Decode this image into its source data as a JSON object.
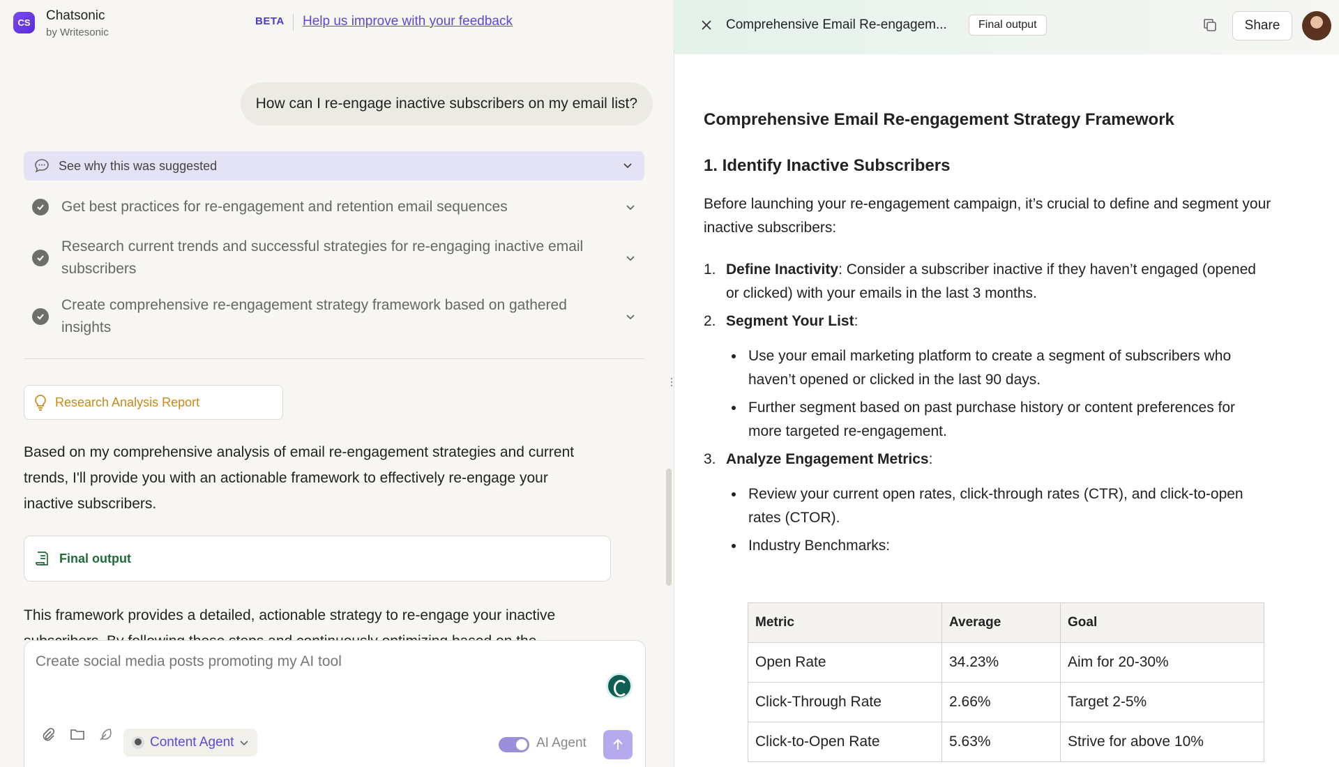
{
  "header": {
    "logo_text": "CS",
    "app_name": "Chatsonic",
    "app_sub": "by Writesonic",
    "beta": "BETA",
    "feedback_link": "Help us improve with your feedback"
  },
  "chat": {
    "user_message": "How can I re-engage inactive subscribers on my email list?",
    "why_suggested": "See why this was suggested",
    "steps": [
      "Get best practices for re-engagement and retention email sequences",
      "Research current trends and successful strategies for re-engaging inactive email subscribers",
      "Create comprehensive re-engagement strategy framework based on gathered insights"
    ],
    "report_card": "Research Analysis Report",
    "analysis_text": "Based on my comprehensive analysis of email re-engagement strategies and current trends, I'll provide you with an actionable framework to effectively re-engage your inactive subscribers.",
    "final_output_card": "Final output",
    "framework_text": "This framework provides a detailed, actionable strategy to re-engage your inactive subscribers. By following these steps and continuously optimizing based on the"
  },
  "composer": {
    "placeholder": "Create social media posts promoting my AI tool",
    "agent_label": "Content Agent",
    "ai_agent_label": "AI Agent",
    "ai_agent_enabled": true
  },
  "doc_panel": {
    "title": "Comprehensive Email Re-engagem...",
    "badge": "Final output",
    "share": "Share",
    "heading": "Comprehensive Email Re-engagement Strategy Framework",
    "section": "1. Identify Inactive Subscribers",
    "intro": "Before launching your re-engagement campaign, it’s crucial to define and segment your inactive subscribers:",
    "items": [
      {
        "num": "1.",
        "bold": "Define Inactivity",
        "text": ": Consider a subscriber inactive if they haven’t engaged (opened or clicked) with your emails in the last 3 months."
      },
      {
        "num": "2.",
        "bold": "Segment Your List",
        "text": ":"
      },
      {
        "num": "3.",
        "bold": "Analyze Engagement Metrics",
        "text": ":"
      }
    ],
    "segment_bullets": [
      "Use your email marketing platform to create a segment of subscribers who haven’t opened or clicked in the last 90 days.",
      "Further segment based on past purchase history or content preferences for more targeted re-engagement."
    ],
    "metric_bullets": [
      "Review your current open rates, click-through rates (CTR), and click-to-open rates (CTOR).",
      "Industry Benchmarks:"
    ],
    "table": {
      "headers": [
        "Metric",
        "Average",
        "Goal"
      ],
      "rows": [
        [
          "Open Rate",
          "34.23%",
          "Aim for 20-30%"
        ],
        [
          "Click-Through Rate",
          "2.66%",
          "Target 2-5%"
        ],
        [
          "Click-to-Open Rate",
          "5.63%",
          "Strive for above 10%"
        ]
      ]
    }
  },
  "colors": {
    "accent": "#5b48d8",
    "report": "#c88a17",
    "final": "#1f6b3a"
  }
}
